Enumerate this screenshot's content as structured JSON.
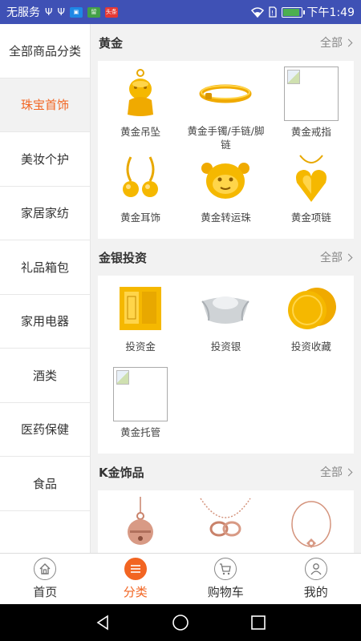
{
  "status_bar": {
    "carrier": "无服务",
    "time": "下午1:49",
    "badge_1": "留",
    "badge_2": "头条"
  },
  "sidebar": {
    "items": [
      {
        "label": "全部商品分类",
        "active": false
      },
      {
        "label": "珠宝首饰",
        "active": true
      },
      {
        "label": "美妆个护",
        "active": false
      },
      {
        "label": "家居家纺",
        "active": false
      },
      {
        "label": "礼品箱包",
        "active": false
      },
      {
        "label": "家用电器",
        "active": false
      },
      {
        "label": "酒类",
        "active": false
      },
      {
        "label": "医药保健",
        "active": false
      },
      {
        "label": "食品",
        "active": false
      }
    ]
  },
  "sections": [
    {
      "title": "黄金",
      "all_label": "全部",
      "products": [
        {
          "name": "黄金吊坠",
          "icon": "gold-pendant-icon"
        },
        {
          "name": "黄金手镯/手链/脚链",
          "icon": "gold-bracelet-icon"
        },
        {
          "name": "黄金戒指",
          "icon": "broken-image-icon"
        },
        {
          "name": "黄金耳饰",
          "icon": "gold-earrings-icon"
        },
        {
          "name": "黄金转运珠",
          "icon": "gold-bead-icon"
        },
        {
          "name": "黄金项链",
          "icon": "gold-necklace-icon"
        }
      ]
    },
    {
      "title": "金银投资",
      "all_label": "全部",
      "products": [
        {
          "name": "投资金",
          "icon": "gold-bar-icon"
        },
        {
          "name": "投资银",
          "icon": "silver-ingot-icon"
        },
        {
          "name": "投资收藏",
          "icon": "gold-coin-icon"
        },
        {
          "name": "黄金托管",
          "icon": "broken-image-icon"
        }
      ]
    },
    {
      "title": "K金饰品",
      "all_label": "全部",
      "products": [
        {
          "name": "",
          "icon": "rose-gold-bell-pendant-icon"
        },
        {
          "name": "",
          "icon": "rose-gold-necklace-icon"
        },
        {
          "name": "",
          "icon": "rose-gold-bracelet-icon"
        }
      ]
    }
  ],
  "bottom_nav": {
    "items": [
      {
        "label": "首页",
        "icon": "home-icon",
        "active": false
      },
      {
        "label": "分类",
        "icon": "category-list-icon",
        "active": true
      },
      {
        "label": "购物车",
        "icon": "cart-icon",
        "active": false
      },
      {
        "label": "我的",
        "icon": "user-icon",
        "active": false
      }
    ]
  },
  "colors": {
    "accent": "#f26522",
    "status_bar": "#3f51b5",
    "gold": "#f5b800"
  }
}
